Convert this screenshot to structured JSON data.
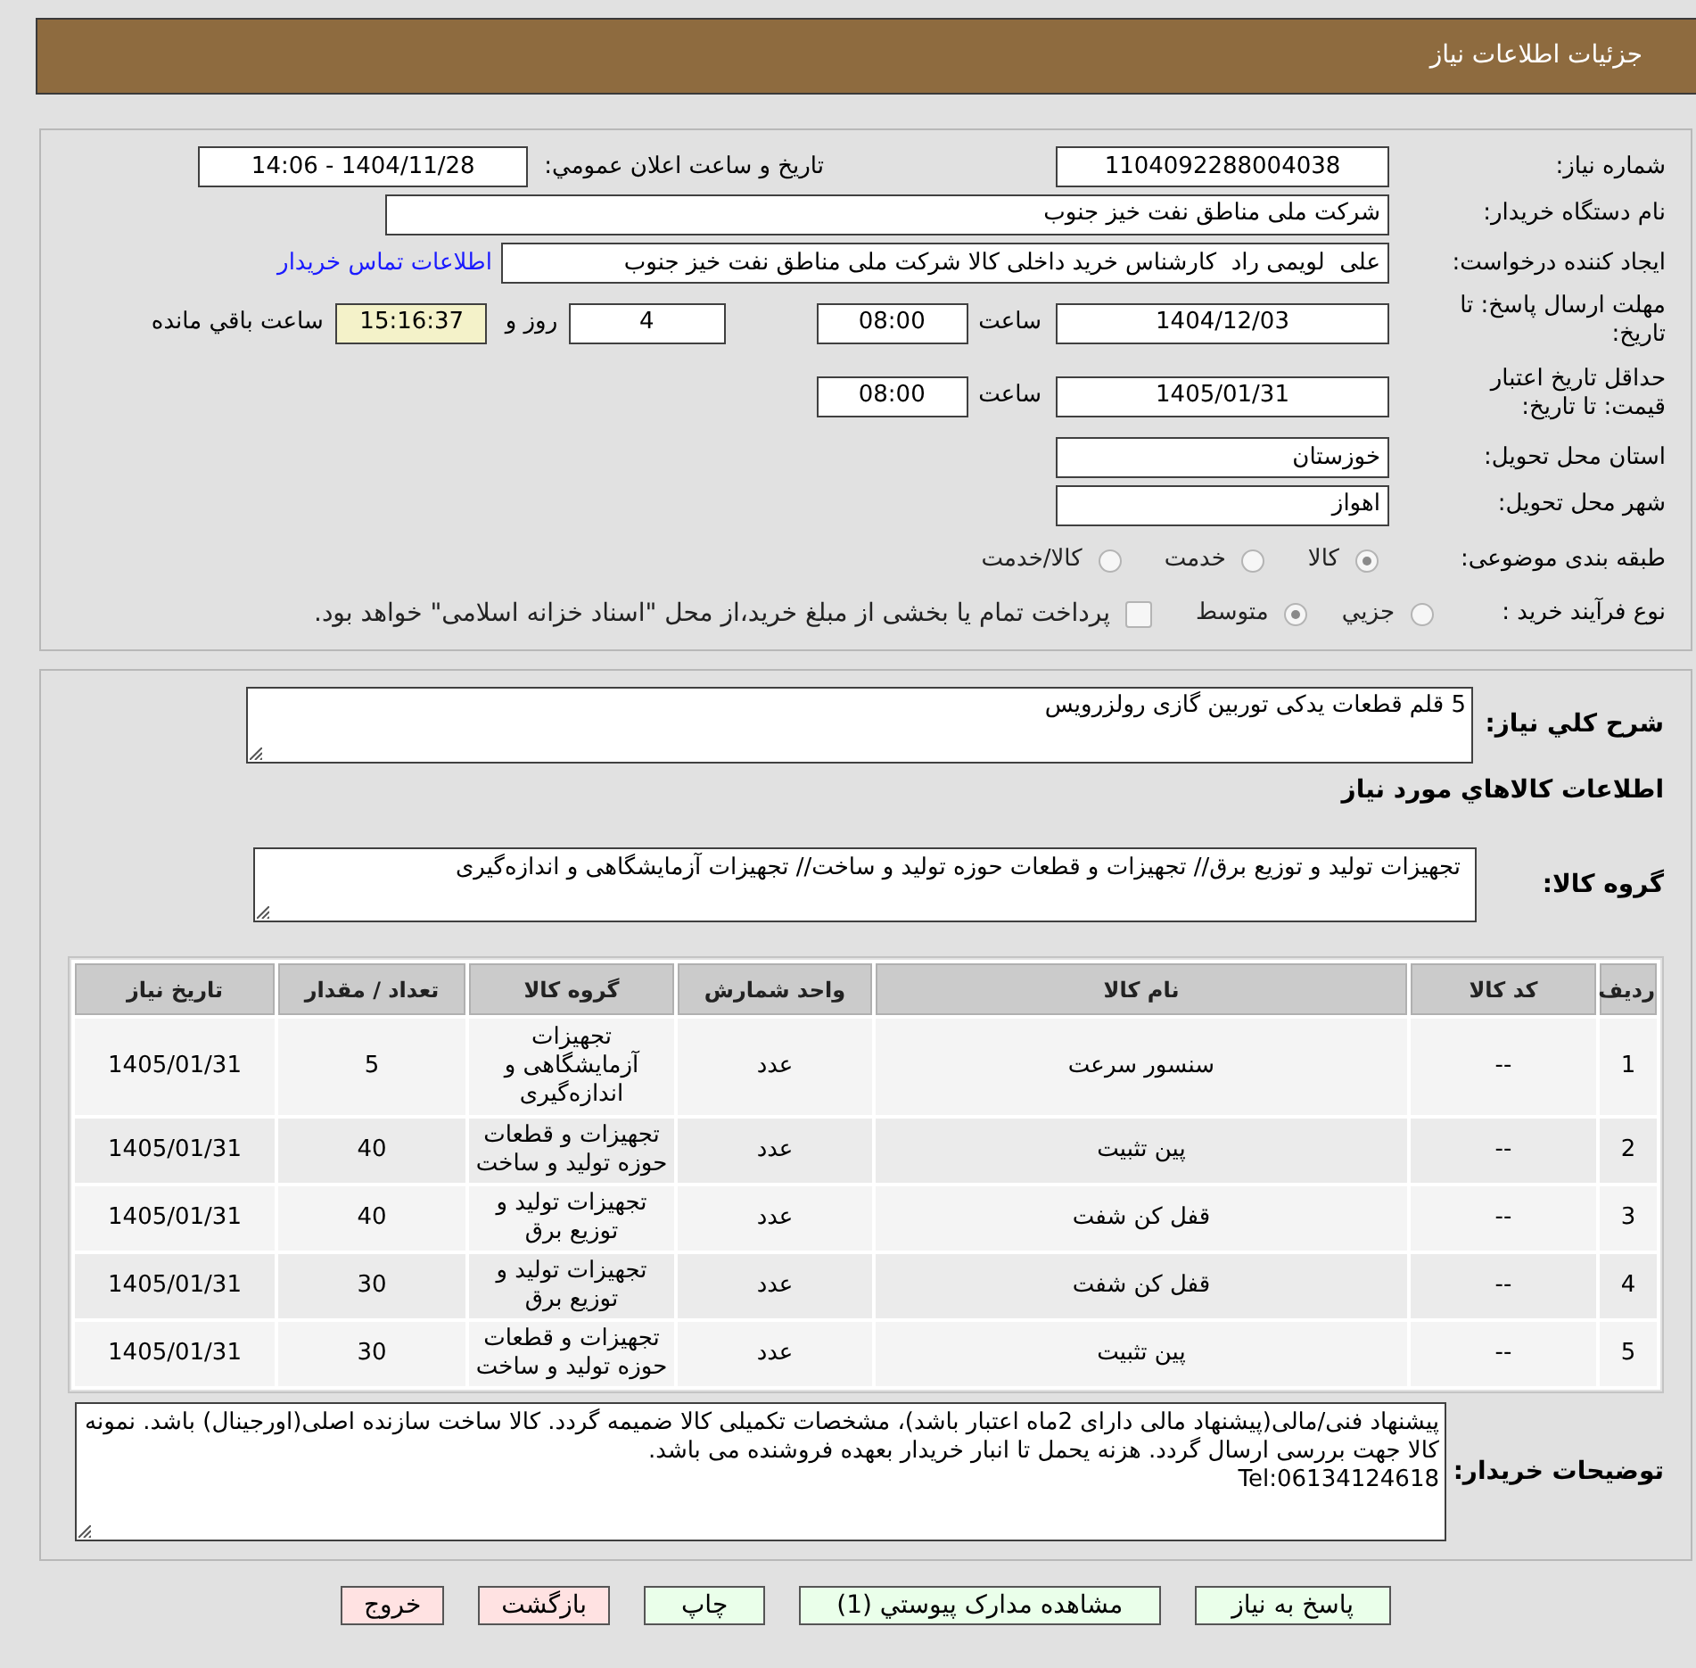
{
  "header": {
    "title": "جزئیات اطلاعات نیاز"
  },
  "details": {
    "need_number": {
      "label": "شماره نیاز:",
      "value": "1104092288004038"
    },
    "announce_datetime": {
      "label": "تاریخ و ساعت اعلان عمومي:",
      "value": "1404/11/28 - 14:06"
    },
    "buyer_org": {
      "label": "نام دستگاه خریدار:",
      "value": "شرکت ملی مناطق نفت خیز جنوب"
    },
    "requester": {
      "label": "ایجاد کننده درخواست:",
      "value": "علی  لویمی راد  کارشناس خرید داخلی کالا شرکت ملی مناطق نفت خیز جنوب",
      "contact_link": "اطلاعات تماس خریدار"
    },
    "reply_deadline": {
      "label": "مهلت ارسال پاسخ: تا تاریخ:",
      "date": "1404/12/03",
      "time_label": "ساعت",
      "time": "08:00",
      "days": "4",
      "days_label": "روز و",
      "remaining": "15:16:37",
      "remaining_label": "ساعت باقي مانده"
    },
    "price_validity": {
      "label": "حداقل تاریخ اعتبار قیمت: تا تاریخ:",
      "date": "1405/01/31",
      "time_label": "ساعت",
      "time": "08:00"
    },
    "delivery_province": {
      "label": "استان محل تحویل:",
      "value": "خوزستان"
    },
    "delivery_city": {
      "label": "شهر محل تحویل:",
      "value": "اهواز"
    },
    "category": {
      "label": "طبقه بندی موضوعی:",
      "options": [
        {
          "label": "کالا",
          "selected": true
        },
        {
          "label": "خدمت",
          "selected": false
        },
        {
          "label": "کالا/خدمت",
          "selected": false
        }
      ]
    },
    "purchase_process": {
      "label": "نوع فرآیند خرید :",
      "options": [
        {
          "label": "جزيي",
          "selected": false
        },
        {
          "label": "متوسط",
          "selected": true
        }
      ],
      "treasury_payment": {
        "label": "پرداخت تمام یا بخشی از مبلغ خرید،از محل \"اسناد خزانه اسلامی\" خواهد بود.",
        "checked": false
      }
    }
  },
  "summary": {
    "label": "شرح کلي نیاز:",
    "value": "5 قلم قطعات یدکی توربین گازی رولزرویس"
  },
  "goods_title": "اطلاعات کالاهاي مورد نیاز",
  "goods_group": {
    "label": "گروه کالا:",
    "value": "تجهیزات تولید و توزیع برق// تجهیزات و قطعات حوزه تولید و ساخت// تجهیزات آزمایشگاهی و اندازه‌گیری"
  },
  "table": {
    "columns": [
      "ردیف",
      "کد کالا",
      "نام کالا",
      "واحد شمارش",
      "گروه کالا",
      "تعداد / مقدار",
      "تاریخ نیاز"
    ],
    "rows": [
      [
        "1",
        "--",
        "سنسور سرعت",
        "عدد",
        "تجهیزات آزمایشگاهی و اندازه‌گیری",
        "5",
        "1405/01/31"
      ],
      [
        "2",
        "--",
        "پین تثبیت",
        "عدد",
        "تجهیزات و قطعات حوزه تولید و ساخت",
        "40",
        "1405/01/31"
      ],
      [
        "3",
        "--",
        "قفل کن شفت",
        "عدد",
        "تجهیزات تولید و توزیع برق",
        "40",
        "1405/01/31"
      ],
      [
        "4",
        "--",
        "قفل کن شفت",
        "عدد",
        "تجهیزات تولید و توزیع برق",
        "30",
        "1405/01/31"
      ],
      [
        "5",
        "--",
        "پین تثبیت",
        "عدد",
        "تجهیزات و قطعات حوزه تولید و ساخت",
        "30",
        "1405/01/31"
      ]
    ]
  },
  "buyer_notes": {
    "label": "توضیحات خریدار:",
    "value": "پیشنهاد فنی/مالی(پیشنهاد مالی دارای 2ماه اعتبار باشد)، مشخصات تکمیلی کالا ضمیمه گردد. کالا ساخت سازنده اصلی(اورجینال) باشد. نمونه کالا جهت بررسی ارسال گردد. هزنه یحمل تا انبار خریدار بعهده فروشنده می باشد.\nTel:06134124618"
  },
  "buttons": [
    {
      "label": "پاسخ به نیاز",
      "kind": "confirm"
    },
    {
      "label": "مشاهده مدارک پیوستي (1)",
      "kind": "confirm"
    },
    {
      "label": "چاپ",
      "kind": "confirm"
    },
    {
      "label": "بازگشت",
      "kind": "exit"
    },
    {
      "label": "خروج",
      "kind": "exit"
    }
  ]
}
